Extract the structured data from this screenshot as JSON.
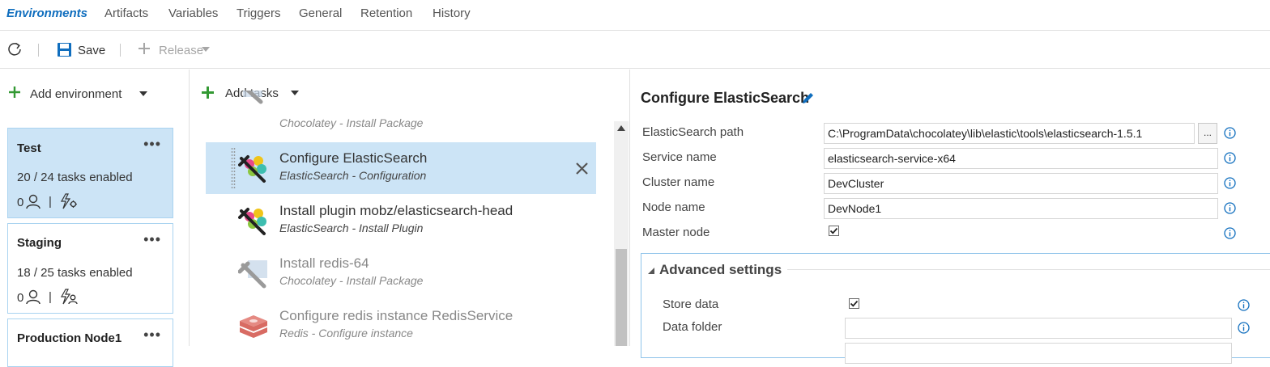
{
  "tabs": [
    {
      "label": "Environments",
      "active": true
    },
    {
      "label": "Artifacts"
    },
    {
      "label": "Variables"
    },
    {
      "label": "Triggers"
    },
    {
      "label": "General"
    },
    {
      "label": "Retention"
    },
    {
      "label": "History"
    }
  ],
  "toolbar": {
    "refresh_icon": "refresh-icon",
    "save_label": "Save",
    "release_label": "Release"
  },
  "environments": {
    "add_label": "Add environment",
    "items": [
      {
        "name": "Test",
        "more": "•••",
        "tasks": "20 / 24 tasks enabled",
        "approvers": "0"
      },
      {
        "name": "Staging",
        "more": "•••",
        "tasks": "18 / 25 tasks enabled",
        "approvers": "0"
      },
      {
        "name": "Production Node1",
        "more": "•••"
      }
    ]
  },
  "tasks": {
    "add_label": "Add tasks",
    "items": [
      {
        "title": "",
        "subtitle": "Chocolatey - Install Package",
        "icon": "chocolatey-icon"
      },
      {
        "title": "Configure ElasticSearch",
        "subtitle": "ElasticSearch - Configuration",
        "icon": "elasticsearch-icon"
      },
      {
        "title": "Install plugin mobz/elasticsearch-head",
        "subtitle": "ElasticSearch - Install Plugin",
        "icon": "elasticsearch-icon"
      },
      {
        "title": "Install redis-64",
        "subtitle": "Chocolatey - Install Package",
        "icon": "chocolatey-icon"
      },
      {
        "title": "Configure redis instance RedisService",
        "subtitle": "Redis - Configure instance",
        "icon": "redis-icon"
      }
    ]
  },
  "detail": {
    "title": "Configure ElasticSearch",
    "fields": [
      {
        "label": "ElasticSearch path",
        "value": "C:\\ProgramData\\chocolatey\\lib\\elastic\\tools\\elasticsearch-1.5.1",
        "browse": "..."
      },
      {
        "label": "Service name",
        "value": "elasticsearch-service-x64"
      },
      {
        "label": "Cluster name",
        "value": "DevCluster"
      },
      {
        "label": "Node name",
        "value": "DevNode1"
      },
      {
        "label": "Master node",
        "checked": true
      }
    ],
    "advanced": {
      "title": "Advanced settings",
      "fields": [
        {
          "label": "Store data",
          "checked": true
        },
        {
          "label": "Data folder",
          "value": ""
        }
      ]
    }
  },
  "colors": {
    "accent": "#106ebe",
    "selected_bg": "#cce4f6",
    "card_border": "#a9d3f0",
    "green_plus": "#339933"
  }
}
